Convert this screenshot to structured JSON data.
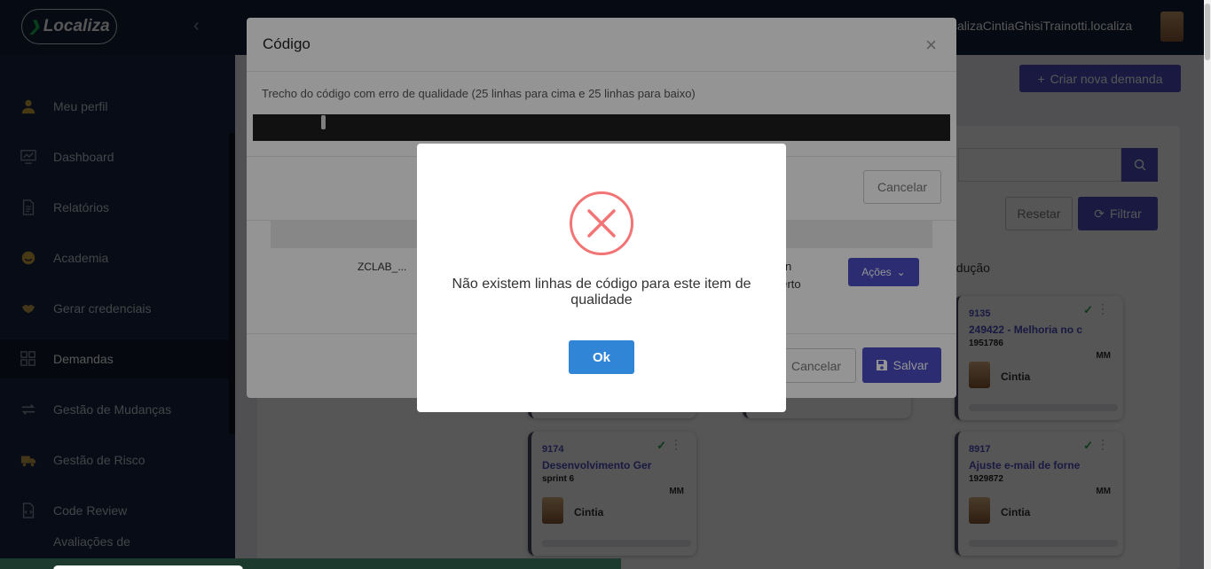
{
  "header": {
    "logo_text": "Localiza",
    "user_name": "calizaCintiaGhisiTrainotti.localiza"
  },
  "sidebar": {
    "items": [
      {
        "label": "Meu perfil",
        "icon": "user-icon"
      },
      {
        "label": "Dashboard",
        "icon": "monitor-icon"
      },
      {
        "label": "Relatórios",
        "icon": "document-icon"
      },
      {
        "label": "Academia",
        "icon": "smile-icon"
      },
      {
        "label": "Gerar credenciais",
        "icon": "handshake-icon"
      },
      {
        "label": "Demandas",
        "icon": "grid-icon"
      },
      {
        "label": "Gestão de Mudanças",
        "icon": "swap-icon"
      },
      {
        "label": "Gestão de Risco",
        "icon": "truck-icon"
      },
      {
        "label": "Code Review",
        "icon": "file-code-icon"
      },
      {
        "label": "Avaliações de",
        "icon": "star-icon"
      }
    ]
  },
  "main": {
    "create_button": "Criar nova demanda",
    "reset_button": "Resetar",
    "filter_button": "Filtrar",
    "column_title": "odução",
    "cards": [
      {
        "num": "9135",
        "title": "249422 - Melhoria no c",
        "sub": "1951786",
        "initials": "MM",
        "owner": "Cintia"
      },
      {
        "num": "9174",
        "title": "Desenvolvimento Ger",
        "sub": "sprint 6",
        "initials": "MM",
        "owner": "Cintia"
      },
      {
        "num": "8917",
        "title": "Ajuste e-mail de forne",
        "sub": "1929872",
        "initials": "MM",
        "owner": "Cintia"
      }
    ]
  },
  "code_modal": {
    "title": "Código",
    "close": "×",
    "description": "Trecho do código com erro de qualidade (25 linhas para cima e 25 linhas para baixo)",
    "cancel_top": "Cancelar",
    "row_cell_1": "ZCLAB_...",
    "row_cell_2a": "n",
    "row_cell_2b": "berto",
    "actions_button": "Ações",
    "cancel_bottom": "Cancelar",
    "save_button": "Salvar"
  },
  "alert": {
    "message": "Não existem linhas de código para este item de qualidade",
    "ok_button": "Ok",
    "icon_color": "#f27474"
  },
  "colors": {
    "primary": "#4b4dc4",
    "topbar": "#16203a",
    "sidebar": "#1b2742",
    "ok": "#3085d6"
  }
}
